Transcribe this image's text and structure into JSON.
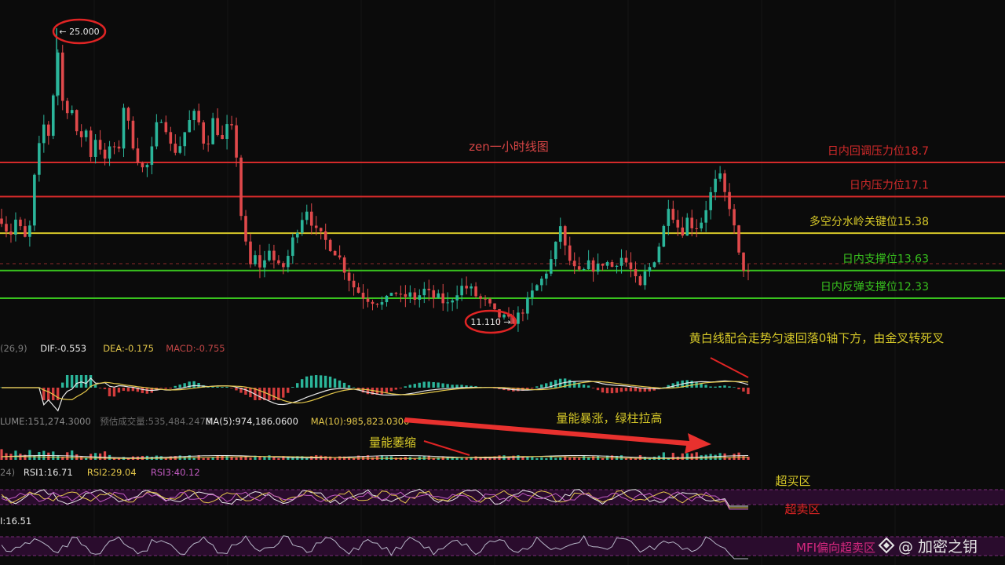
{
  "chart_data": {
    "type": "candlestick",
    "title": "zen一小时线图",
    "price_labels": {
      "high": "← 25.000",
      "low": "11.110 →"
    },
    "levels": [
      {
        "label": "日内回调压力位18.7",
        "value": 18.7,
        "color": "#d42a2a"
      },
      {
        "label": "日内压力位17.1",
        "value": 17.1,
        "color": "#d42a2a"
      },
      {
        "label": "多空分水岭关键位15.38",
        "value": 15.38,
        "color": "#d6c828"
      },
      {
        "label": "日内支撑位13.63",
        "value": 13.63,
        "color": "#38c21e"
      },
      {
        "label": "日内反弹支撑位12.33",
        "value": 12.33,
        "color": "#38c21e"
      }
    ],
    "price_path": [
      [
        0,
        16.2
      ],
      [
        6,
        15.8
      ],
      [
        12,
        15.2
      ],
      [
        20,
        16.0
      ],
      [
        28,
        15.4
      ],
      [
        36,
        14.8
      ],
      [
        42,
        17.5
      ],
      [
        48,
        19.0
      ],
      [
        55,
        20.5
      ],
      [
        62,
        20.0
      ],
      [
        68,
        22.0
      ],
      [
        72,
        25.0
      ],
      [
        76,
        22.5
      ],
      [
        82,
        21.0
      ],
      [
        90,
        21.5
      ],
      [
        100,
        19.5
      ],
      [
        108,
        20.5
      ],
      [
        116,
        19.0
      ],
      [
        124,
        20.2
      ],
      [
        132,
        18.5
      ],
      [
        140,
        19.5
      ],
      [
        150,
        19.0
      ],
      [
        158,
        21.5
      ],
      [
        166,
        20.0
      ],
      [
        174,
        19.0
      ],
      [
        184,
        18.2
      ],
      [
        192,
        19.0
      ],
      [
        200,
        20.5
      ],
      [
        208,
        21.0
      ],
      [
        216,
        19.5
      ],
      [
        226,
        19.2
      ],
      [
        236,
        20.2
      ],
      [
        246,
        21.0
      ],
      [
        254,
        20.5
      ],
      [
        262,
        19.3
      ],
      [
        272,
        20.8
      ],
      [
        282,
        19.6
      ],
      [
        292,
        20.6
      ],
      [
        300,
        19.6
      ],
      [
        306,
        16.5
      ],
      [
        312,
        15.0
      ],
      [
        318,
        13.8
      ],
      [
        326,
        14.3
      ],
      [
        334,
        13.6
      ],
      [
        342,
        14.8
      ],
      [
        350,
        14.0
      ],
      [
        358,
        13.6
      ],
      [
        366,
        14.2
      ],
      [
        374,
        15.2
      ],
      [
        384,
        16.1
      ],
      [
        392,
        16.6
      ],
      [
        400,
        15.5
      ],
      [
        410,
        15.2
      ],
      [
        420,
        14.8
      ],
      [
        430,
        14.4
      ],
      [
        440,
        13.6
      ],
      [
        450,
        12.9
      ],
      [
        460,
        12.5
      ],
      [
        470,
        12.3
      ],
      [
        480,
        12.2
      ],
      [
        490,
        12.0
      ],
      [
        500,
        12.8
      ],
      [
        510,
        12.3
      ],
      [
        520,
        12.5
      ],
      [
        530,
        12.3
      ],
      [
        540,
        12.7
      ],
      [
        550,
        12.4
      ],
      [
        560,
        12.3
      ],
      [
        570,
        12.0
      ],
      [
        580,
        12.6
      ],
      [
        590,
        12.9
      ],
      [
        600,
        12.7
      ],
      [
        610,
        12.3
      ],
      [
        620,
        12.1
      ],
      [
        630,
        11.6
      ],
      [
        640,
        11.4
      ],
      [
        650,
        11.2
      ],
      [
        660,
        11.5
      ],
      [
        670,
        12.0
      ],
      [
        680,
        12.7
      ],
      [
        690,
        13.2
      ],
      [
        700,
        13.9
      ],
      [
        708,
        14.8
      ],
      [
        714,
        15.8
      ],
      [
        720,
        14.6
      ],
      [
        730,
        13.7
      ],
      [
        740,
        13.4
      ],
      [
        750,
        13.9
      ],
      [
        760,
        13.7
      ],
      [
        770,
        14.1
      ],
      [
        780,
        13.8
      ],
      [
        790,
        14.3
      ],
      [
        800,
        13.9
      ],
      [
        808,
        13.3
      ],
      [
        814,
        12.6
      ],
      [
        820,
        13.4
      ],
      [
        828,
        13.8
      ],
      [
        836,
        14.4
      ],
      [
        844,
        15.4
      ],
      [
        852,
        16.9
      ],
      [
        860,
        15.9
      ],
      [
        868,
        15.4
      ],
      [
        876,
        16.1
      ],
      [
        884,
        15.6
      ],
      [
        894,
        16.0
      ],
      [
        902,
        16.9
      ],
      [
        910,
        17.7
      ],
      [
        916,
        18.1
      ],
      [
        922,
        17.3
      ],
      [
        930,
        16.6
      ],
      [
        936,
        15.4
      ],
      [
        942,
        14.1
      ],
      [
        948,
        13.7
      ],
      [
        955,
        13.6
      ]
    ],
    "macd": {
      "header": [
        {
          "text": "(26,9)",
          "color": "#7a7a7a"
        },
        {
          "text": "DIF:-0.553",
          "color": "#e8e8e8"
        },
        {
          "text": "DEA:-0.175",
          "color": "#e5c84a"
        },
        {
          "text": "MACD:-0.755",
          "color": "#c24646"
        }
      ],
      "note": "黄白线配合走势匀速回落0轴下方，由金叉转死叉"
    },
    "volume": {
      "header": [
        {
          "text": "LUME:151,274.3000",
          "color": "#8a8a8a"
        },
        {
          "text": "预估成交量:535,484.2478",
          "color": "#6a6a6a"
        },
        {
          "text": "MA(5):974,186.0600",
          "color": "#e8e8e8"
        },
        {
          "text": "MA(10):985,823.0300",
          "color": "#e5c84a"
        }
      ],
      "note_shrink": "量能萎缩",
      "note_surge": "量能暴涨，绿柱拉高"
    },
    "rsi": {
      "header": [
        {
          "text": "24)",
          "color": "#7a7a7a"
        },
        {
          "text": "RSI1:16.71",
          "color": "#e8e8e8"
        },
        {
          "text": "RSI2:29.04",
          "color": "#e5c84a"
        },
        {
          "text": "RSI3:40.12",
          "color": "#c25bc2"
        }
      ],
      "overbought": "超买区",
      "oversold": "超卖区"
    },
    "mfi": {
      "value": "I:16.51",
      "note": "MFI偏向超卖区"
    }
  },
  "watermark": "@ 加密之钥",
  "colors": {
    "up": "#2bb59a",
    "down": "#e0494b",
    "background": "#0b0b0b"
  }
}
